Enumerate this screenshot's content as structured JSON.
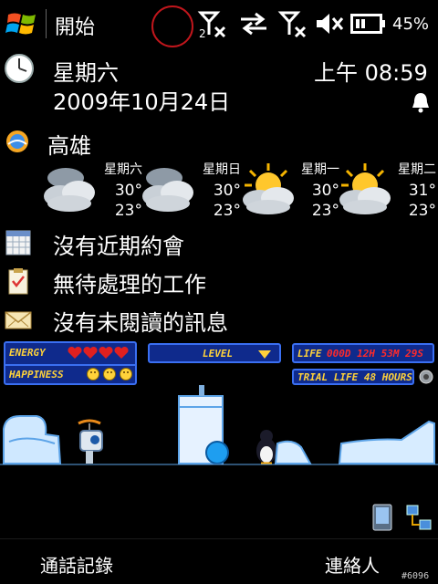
{
  "taskbar": {
    "start_label": "開始",
    "battery_percent": "45%",
    "signal_badge": "2",
    "icons": [
      "windows-flag-icon",
      "signal-off-icon",
      "sync-arrows-icon",
      "signal-off-icon",
      "volume-muted-icon",
      "battery-icon"
    ]
  },
  "clock": {
    "weekday": "星期六",
    "date": "2009年10月24日",
    "time": "上午 08:59"
  },
  "weather": {
    "city": "高雄",
    "forecast": [
      {
        "day": "星期六",
        "high": "30°",
        "low": "23°",
        "icon": "cloudy-icon"
      },
      {
        "day": "星期日",
        "high": "30°",
        "low": "23°",
        "icon": "cloudy-icon"
      },
      {
        "day": "星期一",
        "high": "30°",
        "low": "23°",
        "icon": "partly-cloudy-icon"
      },
      {
        "day": "星期二",
        "high": "31°",
        "low": "23°",
        "icon": "partly-cloudy-icon"
      }
    ]
  },
  "today": {
    "appointments": "沒有近期約會",
    "tasks": "無待處理的工作",
    "messages": "沒有未閱讀的訊息"
  },
  "pet": {
    "energy_label": "ENERGY",
    "happiness_label": "HAPPINESS",
    "energy_hearts": 4,
    "happiness_faces": 3,
    "level_label": "LEVEL",
    "life_label": "LIFE",
    "life_value": "000D 12H 53M 29S",
    "trial_label": "TRIAL LIFE 48 HOURS"
  },
  "softkeys": {
    "left": "通話記錄",
    "right": "連絡人"
  },
  "build_tag": "#6096",
  "colors": {
    "hud_bg": "#0f2a8c",
    "hud_border": "#3a6ff2",
    "hud_text": "#ffd23a",
    "life_digits": "#ff2a2a",
    "focus_ring": "#c0161c"
  }
}
